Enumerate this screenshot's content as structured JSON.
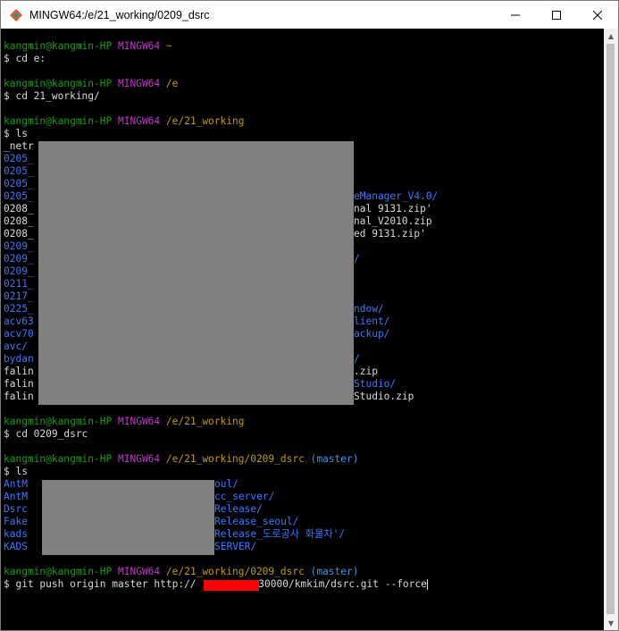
{
  "window": {
    "title": "MINGW64:/e/21_working/0209_dsrc",
    "icon": "git-bash-icon",
    "controls": {
      "minimize": "minimize-icon",
      "maximize": "maximize-icon",
      "close": "close-icon"
    }
  },
  "colors": {
    "user": "#13a10e",
    "host": "#c239c9",
    "path": "#c19c00",
    "branch": "#3a96dd",
    "dir": "#3b78ff",
    "text": "#d9d9d9",
    "redaction": "#808080",
    "redaction_red": "#ff0000"
  },
  "session": [
    {
      "user": "kangmin@kangmin-HP",
      "host": "MINGW64",
      "path": "~",
      "command": "$ cd e:"
    },
    {
      "user": "kangmin@kangmin-HP",
      "host": "MINGW64",
      "path": "/e",
      "command": "$ cd 21_working/"
    },
    {
      "user": "kangmin@kangmin-HP",
      "host": "MINGW64",
      "path": "/e/21_working",
      "command": "$ ls"
    },
    {
      "user": "kangmin@kangmin-HP",
      "host": "MINGW64",
      "path": "/e/21_working",
      "command": "$ cd 0209_dsrc"
    },
    {
      "user": "kangmin@kangmin-HP",
      "host": "MINGW64",
      "path": "/e/21_working/0209_dsrc",
      "branch": "(master)",
      "command": "$ ls"
    },
    {
      "user": "kangmin@kangmin-HP",
      "host": "MINGW64",
      "path": "/e/21_working/0209_dsrc",
      "branch": "(master)",
      "command_prefix": "$ git push origin master http://",
      "command_suffix": ":30000/kmkim/dsrc.git --force"
    }
  ],
  "ls_working": [
    {
      "left": "_netr",
      "right": ""
    },
    {
      "left": "0205_",
      "right": ""
    },
    {
      "left": "0205_",
      "right": ""
    },
    {
      "left": "0205_",
      "right": ""
    },
    {
      "left": "0205_",
      "right": "eManager_V4.0/"
    },
    {
      "left": "0208_",
      "right": "nal 9131.zip'"
    },
    {
      "left": "0208_",
      "right": "nal_V2010.zip"
    },
    {
      "left": "0208_",
      "right": "ed 9131.zip'"
    },
    {
      "left": "0209_",
      "right": ""
    },
    {
      "left": "0209_",
      "right": "/"
    },
    {
      "left": "0209_",
      "right": ""
    },
    {
      "left": "0211_",
      "right": ""
    },
    {
      "left": "0217_",
      "right": ""
    },
    {
      "left": "0225_",
      "right": "ndow/"
    },
    {
      "left": "acv63",
      "right": "lient/"
    },
    {
      "left": "acv70",
      "right": "ackup/"
    },
    {
      "left": "avc/",
      "right": ""
    },
    {
      "left": "bydan",
      "right": "/"
    },
    {
      "left": "falin",
      "right": ".zip"
    },
    {
      "left": "falin",
      "right": "Studio/"
    },
    {
      "left": "falin",
      "right": "Studio.zip"
    }
  ],
  "ls_dsrc": [
    {
      "left": "AntM",
      "right": "oul/"
    },
    {
      "left": "AntM",
      "right": "cc_server/"
    },
    {
      "left": "Dsrc",
      "right": "Release/"
    },
    {
      "left": "Fake",
      "right": "Release_seoul/"
    },
    {
      "left": "kads",
      "right": "Release_도로공사 화물차'/"
    },
    {
      "left": "KADS",
      "right": "SERVER/"
    }
  ]
}
